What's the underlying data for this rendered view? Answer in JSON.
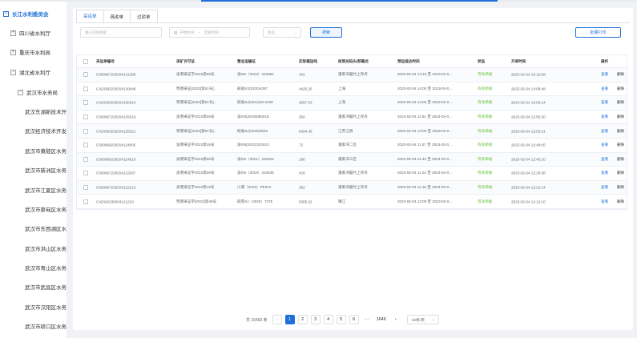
{
  "sidebar": {
    "items": [
      {
        "label": "长江水利委员会",
        "toggle": "−",
        "level": "root"
      },
      {
        "label": "四川省水利厅",
        "toggle": "+",
        "level": "province"
      },
      {
        "label": "重庆市水利局",
        "toggle": "+",
        "level": "province"
      },
      {
        "label": "湖北省水利厅",
        "toggle": "−",
        "level": "province"
      },
      {
        "label": "武汉市水务局",
        "toggle": "−",
        "level": "city"
      },
      {
        "label": "武汉东湖新技术开",
        "toggle": "",
        "level": "district"
      },
      {
        "label": "武汉经济技术开发",
        "toggle": "",
        "level": "district"
      },
      {
        "label": "武汉市黄陂区水务",
        "toggle": "",
        "level": "district"
      },
      {
        "label": "武汉市新洲区水务",
        "toggle": "",
        "level": "district"
      },
      {
        "label": "武汉市江夏区水务",
        "toggle": "",
        "level": "district"
      },
      {
        "label": "武汉市蔡甸区水务",
        "toggle": "",
        "level": "district"
      },
      {
        "label": "武汉市东西湖区水",
        "toggle": "",
        "level": "district"
      },
      {
        "label": "武汉市洪山区水务",
        "toggle": "",
        "level": "district"
      },
      {
        "label": "武汉市青山区水务",
        "toggle": "",
        "level": "district"
      },
      {
        "label": "武汉市武昌区水务",
        "toggle": "",
        "level": "district"
      },
      {
        "label": "武汉市汉阳区水务",
        "toggle": "",
        "level": "district"
      },
      {
        "label": "武汉市硚口区水务",
        "toggle": "",
        "level": "district"
      }
    ]
  },
  "tabs": [
    {
      "label": "采运单",
      "active": true
    },
    {
      "label": "疏浚单",
      "active": false
    },
    {
      "label": "过驳单",
      "active": false
    }
  ],
  "filters": {
    "search_placeholder": "输入内容搜索",
    "date_icon": "calendar-icon",
    "date_start_placeholder": "开始时间",
    "date_sep": "~",
    "date_end_placeholder": "结束时间",
    "status_placeholder": "状态",
    "query_label": "搜索",
    "batch_print_label": "批量打印"
  },
  "table": {
    "columns": [
      "采运单编号",
      "采矿许可证",
      "营业运输证",
      "实际载运吨",
      "拟到达码头/卸载点",
      "预运抵达时间",
      "状态",
      "开单时间",
      "操作"
    ],
    "rows": [
      [
        "C5009672302041312​89",
        "渝港采证字2023第09号",
        "渝SN（2019）310082",
        "342",
        "潘家湾临时上岸点",
        "2023-02-04 13:10 至 2023-02-0...",
        "有效单据",
        "2023-02-04 13:12:59"
      ],
      [
        "C42339323020413004​8",
        "鄂港采证[2022]第51号(...",
        "皖亳SJ(2020)4397",
        "4425.25",
        "上海",
        "2023-02-04 14:00 至 2023-02-0...",
        "有效单据",
        "2023-02-04 13:09:48"
      ],
      [
        "C423393230204130314",
        "鄂港采证[2022]第51号(...",
        "皖亳SJ(2021)03-2109",
        "4567.03",
        "上海",
        "2023-02-04 14:00 至 2023-02-0...",
        "有效单据",
        "2023-02-04 13:03:14"
      ],
      [
        "C500967230204125519",
        "渝港采证字2023第08号",
        "渝SN(2019)080018",
        "350",
        "潘家湾临时上岸点",
        "2023-02-04 11:51 至 2023-02-0...",
        "有效单据",
        "2023-02-04 12:55:20"
      ],
      [
        "C423393230204125321",
        "鄂港采证[2022]第51号(...",
        "皖亳SJ(2020)0532",
        "6394.45",
        "江苏江阴",
        "2023-02-04 14:00 至 2023-02-0...",
        "有效单据",
        "2023-02-04 12:53:21"
      ],
      [
        "C500968230204124905",
        "渝港采证字2023第15号",
        "渝SN(2022)310013",
        "72",
        "潘家湾二区",
        "2023-02-04 11:47 至 2023-02-0...",
        "有效单据",
        "2023-02-04 12:49:05"
      ],
      [
        "C500968230204124510",
        "渝港采证字2023第06号",
        "渝SN（2021）310024",
        "186",
        "潘家湾三区",
        "2023-02-04 11:43 至 2023-02-0...",
        "有效单据",
        "2023-02-04 12:45:10"
      ],
      [
        "C500967230204122637",
        "渝港采证字2023第08号",
        "渝SN（2019）310045",
        "428",
        "潘家湾临时上岸点",
        "2023-02-04 11:22 至 2023-02-0...",
        "有效单据",
        "2023-02-04 12:26:38"
      ],
      [
        "C500967230204122213",
        "渝港采证字2023第19号",
        "川濮（2015）PK012",
        "362",
        "潘家湾临时上岸点",
        "2023-02-04 11:18 至 2023-02-0...",
        "有效单据",
        "2023-02-04 12:22:14"
      ],
      [
        "C423202302041212​10",
        "鄂港采证字[2022]第46号",
        "皖芜SJ（2020）7275",
        "5365.32",
        "镇江",
        "2023-02-04 12:09 至 2023-02-0...",
        "有效单据",
        "2023-02-04 12:12:10"
      ]
    ],
    "action_view": "查看",
    "action_delete": "删除"
  },
  "pagination": {
    "total_text": "共 16492 条",
    "prev": "‹",
    "pages": [
      "1",
      "2",
      "3",
      "4",
      "5",
      "6"
    ],
    "ellipsis": "···",
    "last_page": "1646",
    "next": "›",
    "page_size": "10条/页",
    "page_size_icon": "chevron-down-icon",
    "current": "1"
  },
  "colors": {
    "accent": "#1e6fd9",
    "status_valid": "#67c23a",
    "border": "#dcdfe6"
  }
}
